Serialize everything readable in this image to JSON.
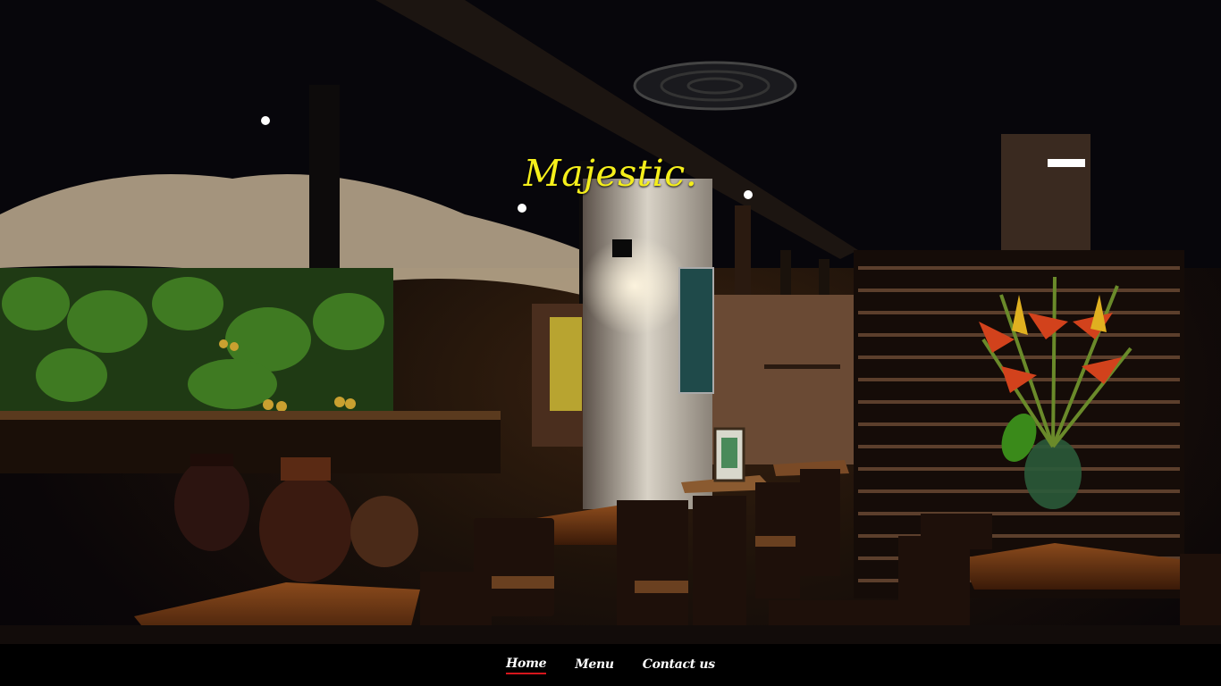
{
  "brand": {
    "title": "Majestic."
  },
  "nav": {
    "items": [
      {
        "label": "Home",
        "active": true
      },
      {
        "label": "Menu",
        "active": false
      },
      {
        "label": "Contact us",
        "active": false
      }
    ]
  },
  "colors": {
    "brand": "#f5ef1b",
    "nav_bg": "#000000",
    "active_underline": "#d6161c"
  }
}
